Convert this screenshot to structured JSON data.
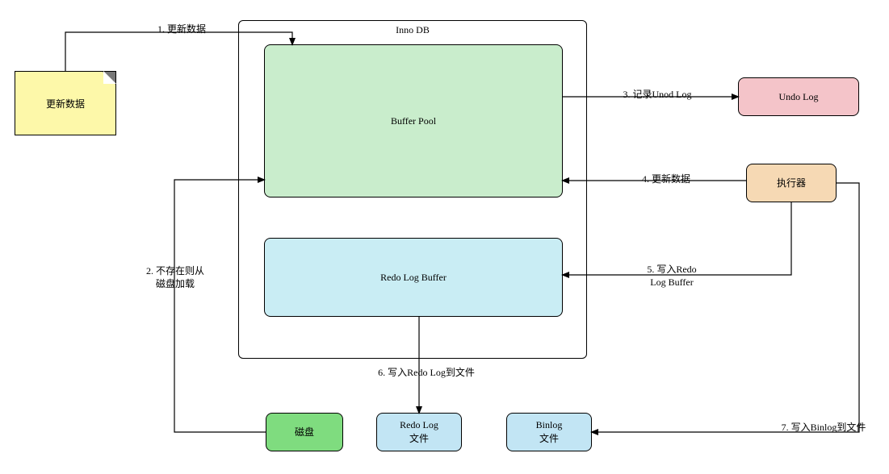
{
  "boxes": {
    "innodb_title": "Inno DB",
    "buffer_pool": "Buffer Pool",
    "redo_log_buffer": "Redo Log Buffer",
    "undo_log": "Undo Log",
    "executor": "执行器",
    "disk": "磁盘",
    "redo_log_file": "Redo Log\n文件",
    "binlog_file": "Binlog\n文件",
    "update_note": "更新数据"
  },
  "edges": {
    "e1": "1. 更新数据",
    "e2": "2. 不存在则从\n磁盘加载",
    "e3": "3. 记录Unod Log",
    "e4": "4. 更新数据",
    "e5": "5. 写入Redo\nLog Buffer",
    "e6": "6. 写入Redo Log到文件",
    "e7": "7. 写入Binlog到文件"
  },
  "colors": {
    "buffer_pool": "#c9edcc",
    "redo_log_buffer": "#c9edf4",
    "undo_log": "#f4c4c9",
    "executor": "#f6d9b4",
    "disk": "#7fdc7f",
    "redo_log_file": "#c2e5f4",
    "binlog_file": "#c2e5f4",
    "note": "#fdf8a9"
  }
}
